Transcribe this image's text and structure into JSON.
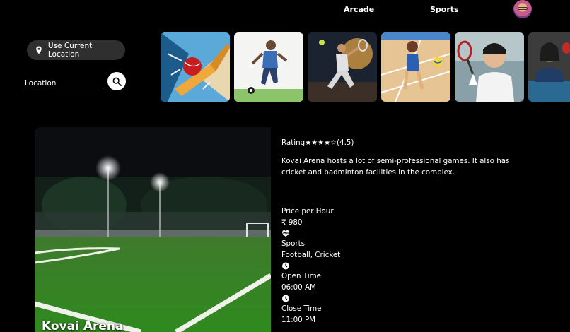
{
  "nav": {
    "arcade": "Arcade",
    "sports": "Sports"
  },
  "location": {
    "use_current_label": "Use Current Location",
    "input_placeholder": "Location"
  },
  "categories": [
    {
      "name": "cricket",
      "icon": "cricket-bat-ball-image"
    },
    {
      "name": "football",
      "icon": "football-player-image"
    },
    {
      "name": "tennis",
      "icon": "tennis-player-image"
    },
    {
      "name": "volleyball",
      "icon": "volleyball-player-image"
    },
    {
      "name": "badminton",
      "icon": "badminton-player-image"
    },
    {
      "name": "table-tennis",
      "icon": "table-tennis-player-image"
    }
  ],
  "venue": {
    "name": "Kovai Arena",
    "rating_label": "Rating",
    "stars_filled": 4,
    "stars_total": 5,
    "rating_value": "(4.5)",
    "description": "Kovai Arena hosts a lot of semi-professional games. It also has cricket and badminton facilities in the complex.",
    "price_label": "Price per Hour",
    "price_value": "₹ 980",
    "sports_label": "Sports",
    "sports_value": "Football, Cricket",
    "open_label": "Open Time",
    "open_value": "06:00 AM",
    "close_label": "Close Time",
    "close_value": "11:00 PM"
  }
}
